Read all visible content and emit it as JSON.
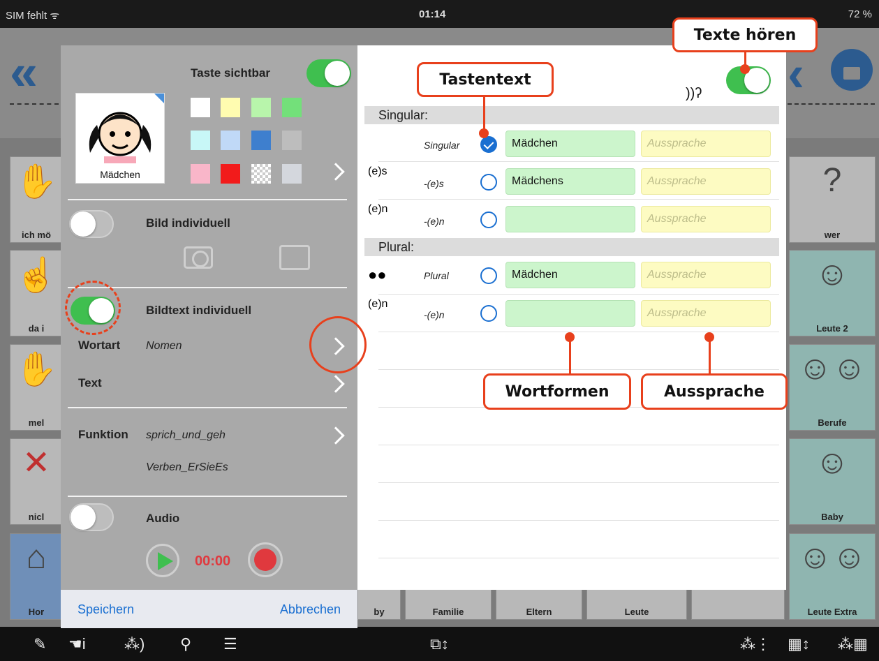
{
  "status_bar": {
    "carrier": "SIM fehlt ᯤ",
    "time": "01:14",
    "battery": "72 %"
  },
  "background_tiles": [
    {
      "label": "ich mö",
      "icon": "hand-sign-icon"
    },
    {
      "label": "da i",
      "icon": "pointing-hand-icon"
    },
    {
      "label": "mel",
      "icon": "hand-dots-icon"
    },
    {
      "label": "nicl",
      "icon": "cross-icon"
    },
    {
      "label": "Hor",
      "icon": "house-icon"
    },
    {
      "label": "wer",
      "icon": "question-person-icon"
    },
    {
      "label": "Leute 2",
      "icon": "grandma-icon"
    },
    {
      "label": "Berufe",
      "icon": "professions-icon"
    },
    {
      "label": "Baby",
      "icon": "baby-icon"
    },
    {
      "label": "Leute Extra",
      "icon": "people-group-icon"
    }
  ],
  "bottom_tiles": [
    "by",
    "Familie",
    "Eltern",
    "Leute",
    ""
  ],
  "left_panel": {
    "taste_sichtbar": "Taste sichtbar",
    "preview_name": "Mädchen",
    "swatch_colors": [
      "#ffffff",
      "#fffcb0",
      "#b8f5ab",
      "#73e07a",
      "#c8f7f7",
      "#c0d9f7",
      "#3e7fce",
      "#bdbdbd",
      "#f9b6c9",
      "#f21b1b",
      "checker",
      "#d4d7dd"
    ],
    "bild_individuell": "Bild individuell",
    "bildtext_individuell": "Bildtext individuell",
    "wortart_label": "Wortart",
    "wortart_value": "Nomen",
    "text_label": "Text",
    "funktion_label": "Funktion",
    "funktion_value1": "sprich_und_geh",
    "funktion_value2": "Verben_ErSieEs",
    "audio_label": "Audio",
    "audio_time": "00:00",
    "save": "Speichern",
    "cancel": "Abbrechen"
  },
  "right_panel": {
    "singular_header": "Singular:",
    "plural_header": "Plural:",
    "rows": [
      {
        "symbol": "",
        "label": "Singular",
        "checked": true,
        "word": "Mädchen",
        "pron": "Aussprache"
      },
      {
        "symbol": "(e)s",
        "label": "-(e)s",
        "checked": false,
        "word": "Mädchens",
        "pron": "Aussprache"
      },
      {
        "symbol": "(e)n",
        "label": "-(e)n",
        "checked": false,
        "word": "",
        "pron": "Aussprache"
      },
      {
        "symbol": "●●",
        "label": "Plural",
        "checked": false,
        "word": "Mädchen",
        "pron": "Aussprache"
      },
      {
        "symbol": "(e)n",
        "label": "-(e)n",
        "checked": false,
        "word": "",
        "pron": "Aussprache"
      }
    ],
    "hear_icon": "))ʔ"
  },
  "callouts": {
    "texte_horen": "Texte hören",
    "tastentext": "Tastentext",
    "wortformen": "Wortformen",
    "aussprache": "Aussprache"
  },
  "toolbar_icons": [
    "pencil-icon",
    "hand-info-icon",
    "speak-icon",
    "search-icon",
    "list-icon",
    "grid-switch-icon",
    "scan-icon",
    "grid-arrows-icon",
    "grid-speak-icon"
  ]
}
